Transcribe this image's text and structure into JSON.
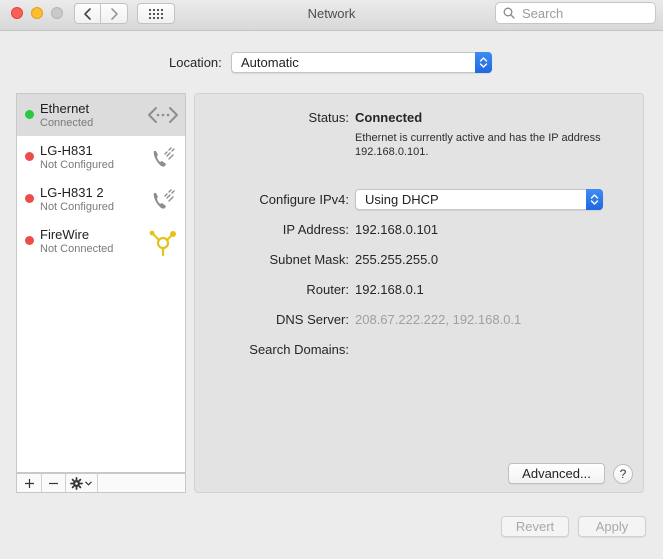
{
  "window": {
    "title": "Network"
  },
  "toolbar": {
    "search_placeholder": "Search"
  },
  "location": {
    "label": "Location:",
    "value": "Automatic"
  },
  "services": [
    {
      "name": "Ethernet",
      "status": "Connected",
      "dot_color": "#28c840",
      "icon": "ethernet-icon"
    },
    {
      "name": "LG-H831",
      "status": "Not Configured",
      "dot_color": "#ee4b4b",
      "icon": "phone-icon"
    },
    {
      "name": "LG-H831 2",
      "status": "Not Configured",
      "dot_color": "#ee4b4b",
      "icon": "phone-icon"
    },
    {
      "name": "FireWire",
      "status": "Not Connected",
      "dot_color": "#ee4b4b",
      "icon": "firewire-icon"
    }
  ],
  "sidebar_controls": {
    "add": "+",
    "remove": "—"
  },
  "details": {
    "status_label": "Status:",
    "status_value": "Connected",
    "status_description": "Ethernet is currently active and has the IP address 192.168.0.101.",
    "configure_label": "Configure IPv4:",
    "configure_value": "Using DHCP",
    "ip_label": "IP Address:",
    "ip_value": "192.168.0.101",
    "subnet_label": "Subnet Mask:",
    "subnet_value": "255.255.255.0",
    "router_label": "Router:",
    "router_value": "192.168.0.1",
    "dns_label": "DNS Server:",
    "dns_value": "208.67.222.222, 192.168.0.1",
    "search_domains_label": "Search Domains:",
    "search_domains_value": ""
  },
  "buttons": {
    "advanced": "Advanced...",
    "help": "?",
    "revert": "Revert",
    "apply": "Apply"
  }
}
